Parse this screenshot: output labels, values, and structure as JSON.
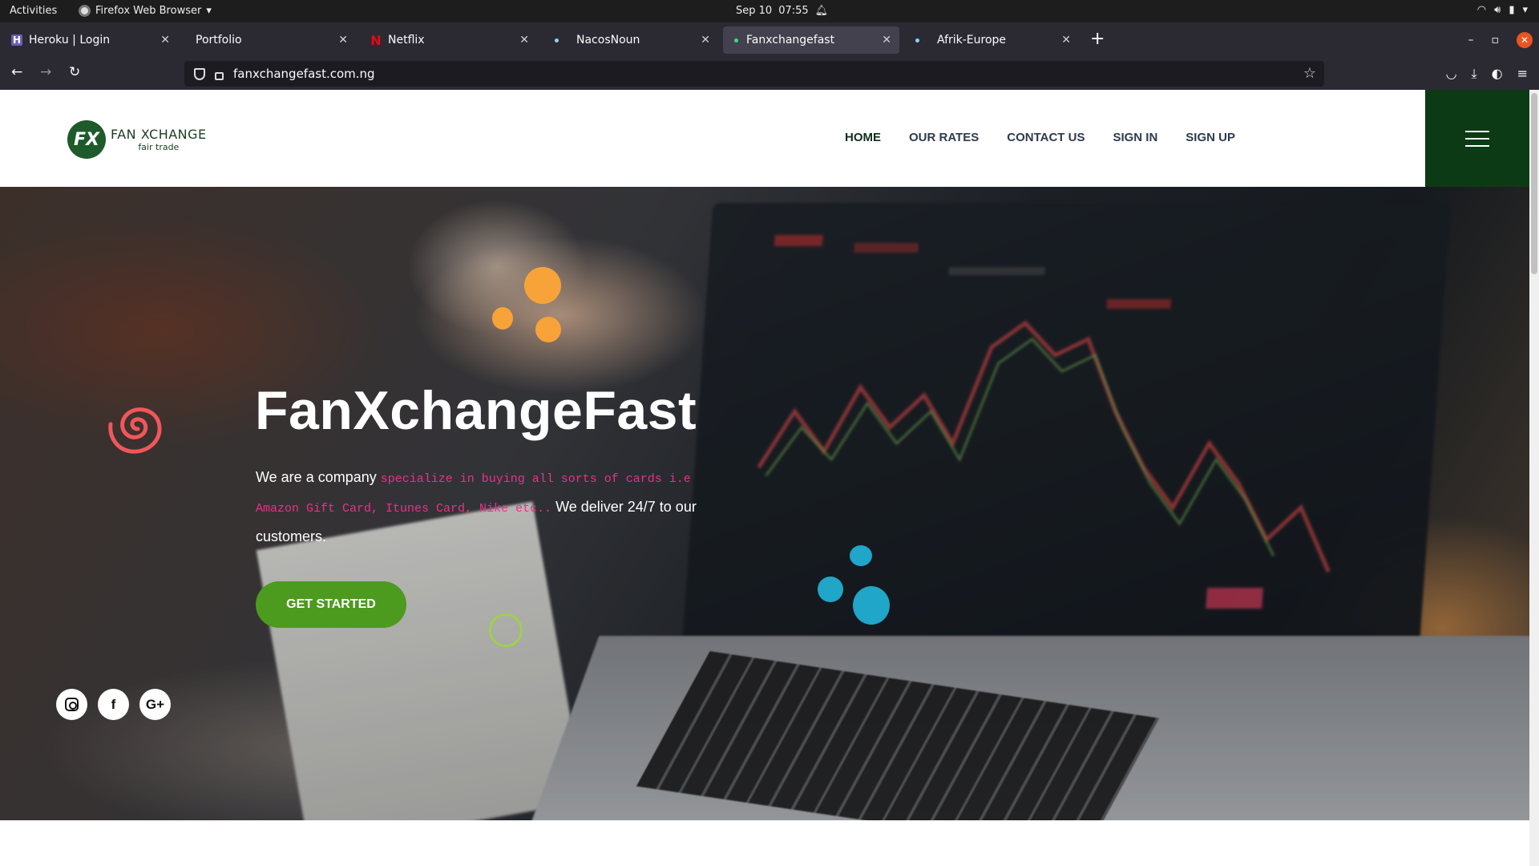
{
  "system_bar": {
    "activities": "Activities",
    "app_name": "Firefox Web Browser",
    "date": "Sep 10",
    "time": "07:55"
  },
  "browser": {
    "tabs": [
      {
        "title": "Heroku | Login",
        "icon": "heroku-icon"
      },
      {
        "title": "Portfolio",
        "icon": "none"
      },
      {
        "title": "Netflix",
        "icon": "netflix-icon"
      },
      {
        "title": "NacosNoun",
        "icon": "dot-icon"
      },
      {
        "title": "Fanxchangefast",
        "icon": "dot-icon",
        "active": true
      },
      {
        "title": "Afrik-Europe",
        "icon": "dot-icon"
      }
    ],
    "url": "fanxchangefast.com.ng"
  },
  "site": {
    "logo": {
      "brand": "FAN XCHANGE",
      "tagline": "fair trade",
      "mark": "FX"
    },
    "menu": [
      "HOME",
      "OUR RATES",
      "CONTACT US",
      "SIGN IN",
      "SIGN UP"
    ],
    "hero": {
      "title": "FanXchangeFast",
      "desc_before": "We are a company ",
      "desc_code": "specialize in buying all sorts of cards i.e Amazon Gift Card, Itunes Card, Nike etc..",
      "desc_after": " We deliver 24/7 to our customers.",
      "cta": "GET STARTED"
    },
    "socials": [
      "instagram-icon",
      "facebook-icon",
      "google-plus-icon"
    ],
    "colors": {
      "primary_green": "#0c3a14",
      "button_green": "#4c9a1e",
      "accent_pink": "#e8318a",
      "orange": "#f7a33a",
      "blue": "#1fa6c8"
    }
  }
}
